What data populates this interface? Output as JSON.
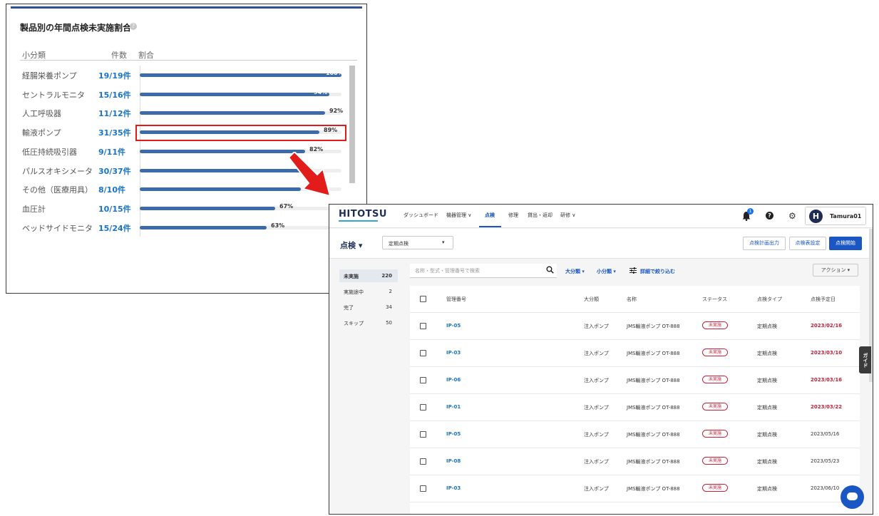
{
  "stats": {
    "title": "製品別の年間点検未実施割合",
    "help_icon": "?",
    "headers": {
      "category": "小分類",
      "count": "件数",
      "ratio": "割合"
    },
    "rows": [
      {
        "category": "経腸栄養ポンプ",
        "count": "19/19件",
        "pct_label": "100%",
        "pct": 100
      },
      {
        "category": "セントラルモニタ",
        "count": "15/16件",
        "pct_label": "94%",
        "pct": 94
      },
      {
        "category": "人工呼吸器",
        "count": "11/12件",
        "pct_label": "92%",
        "pct": 92
      },
      {
        "category": "輸液ポンプ",
        "count": "31/35件",
        "pct_label": "89%",
        "pct": 89
      },
      {
        "category": "低圧持続吸引器",
        "count": "9/11件",
        "pct_label": "82%",
        "pct": 82
      },
      {
        "category": "パルスオキシメータ",
        "count": "30/37件",
        "pct_label": "",
        "pct": 81
      },
      {
        "category": "その他（医療用具）",
        "count": "8/10件",
        "pct_label": "",
        "pct": 80
      },
      {
        "category": "血圧計",
        "count": "10/15件",
        "pct_label": "67%",
        "pct": 67
      },
      {
        "category": "ベッドサイドモニタ",
        "count": "15/24件",
        "pct_label": "63%",
        "pct": 63
      }
    ],
    "highlight_color": "#e21b1b",
    "bar_color": "#3d6aa8"
  },
  "app": {
    "logo": "HITOTSU",
    "nav": [
      "ダッシュボード",
      "機器管理 ∨",
      "点検",
      "修理",
      "貸出・返却",
      "研修 ∨"
    ],
    "active_nav": "点検",
    "notification_count": "1",
    "help": "?",
    "gear": "⚙",
    "user_initial": "H",
    "user_name": "Tamura01",
    "page_title": "点検 ▾",
    "scope_select": {
      "value": "定期点検",
      "caret": "▾"
    },
    "buttons": {
      "export": "点検計画出力",
      "settings": "点検表設定",
      "start": "点検開始"
    },
    "sidebar": [
      {
        "label": "未実施",
        "count": "220"
      },
      {
        "label": "実施途中",
        "count": "2"
      },
      {
        "label": "完了",
        "count": "34"
      },
      {
        "label": "スキップ",
        "count": "50"
      }
    ],
    "search_placeholder": "名称・型式・管理番号で検索",
    "filters": {
      "major": "大分類 ▾",
      "minor": "小分類 ▾",
      "detail": "詳細で絞り込む"
    },
    "action_button": "アクション ▾",
    "table_headers": {
      "id": "管理番号",
      "category": "大分類",
      "name": "名称",
      "status": "ステータス",
      "type": "点検タイプ",
      "due": "点検予定日"
    },
    "rows": [
      {
        "id": "IP-05",
        "category": "注入ポンプ",
        "name": "JMS輸液ポンプ OT-888",
        "status": "未実施",
        "type": "定期点検",
        "due": "2023/02/16",
        "late": true
      },
      {
        "id": "IP-03",
        "category": "注入ポンプ",
        "name": "JMS輸液ポンプ OT-888",
        "status": "未実施",
        "type": "定期点検",
        "due": "2023/03/10",
        "late": true
      },
      {
        "id": "IP-06",
        "category": "注入ポンプ",
        "name": "JMS輸液ポンプ OT-888",
        "status": "未実施",
        "type": "定期点検",
        "due": "2023/03/16",
        "late": true
      },
      {
        "id": "IP-01",
        "category": "注入ポンプ",
        "name": "JMS輸液ポンプ OT-888",
        "status": "未実施",
        "type": "定期点検",
        "due": "2023/03/22",
        "late": true
      },
      {
        "id": "IP-05",
        "category": "注入ポンプ",
        "name": "JMS輸液ポンプ OT-888",
        "status": "未実施",
        "type": "定期点検",
        "due": "2023/05/16",
        "late": false
      },
      {
        "id": "IP-08",
        "category": "注入ポンプ",
        "name": "JMS輸液ポンプ OT-888",
        "status": "未実施",
        "type": "定期点検",
        "due": "2023/05/23",
        "late": false
      },
      {
        "id": "IP-03",
        "category": "注入ポンプ",
        "name": "JMS輸液ポンプ OT-888",
        "status": "未実施",
        "type": "定期点検",
        "due": "2023/06/10",
        "late": false
      }
    ],
    "guide_tab": "ガイド",
    "accent_color": "#1a56c4",
    "late_color": "#c62038"
  }
}
